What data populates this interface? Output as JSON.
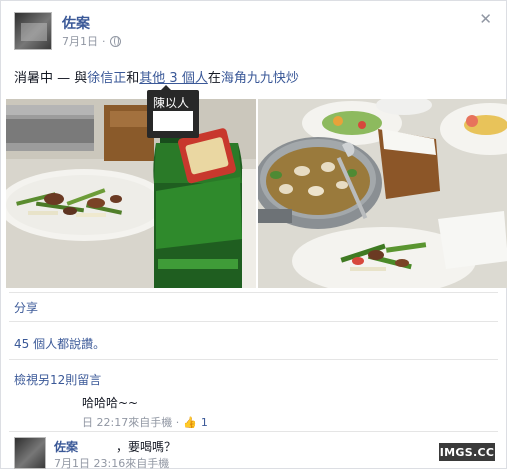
{
  "post": {
    "author": "佐案",
    "date": "7月1日",
    "status_prefix": "消暑中 — 與",
    "tagged_person": "徐信正",
    "status_and": "和",
    "others": "其他 3 個人",
    "status_at": "在",
    "place": "海角九九快炒",
    "tooltip_name": "陳以人"
  },
  "actions": {
    "share": "分享",
    "likes": "45 個人都說讚。",
    "view_more": "檢視另12則留言"
  },
  "comments": [
    {
      "text": "哈哈哈~~",
      "meta": "日 22:17來自手機 ·",
      "like_icon": "thumbs-up-icon",
      "like_count": "1"
    },
    {
      "author": "佐案",
      "text": "，要喝嗎？",
      "meta": "7月1日 23:16來自手機"
    }
  ],
  "watermark": "IMGS.CC"
}
